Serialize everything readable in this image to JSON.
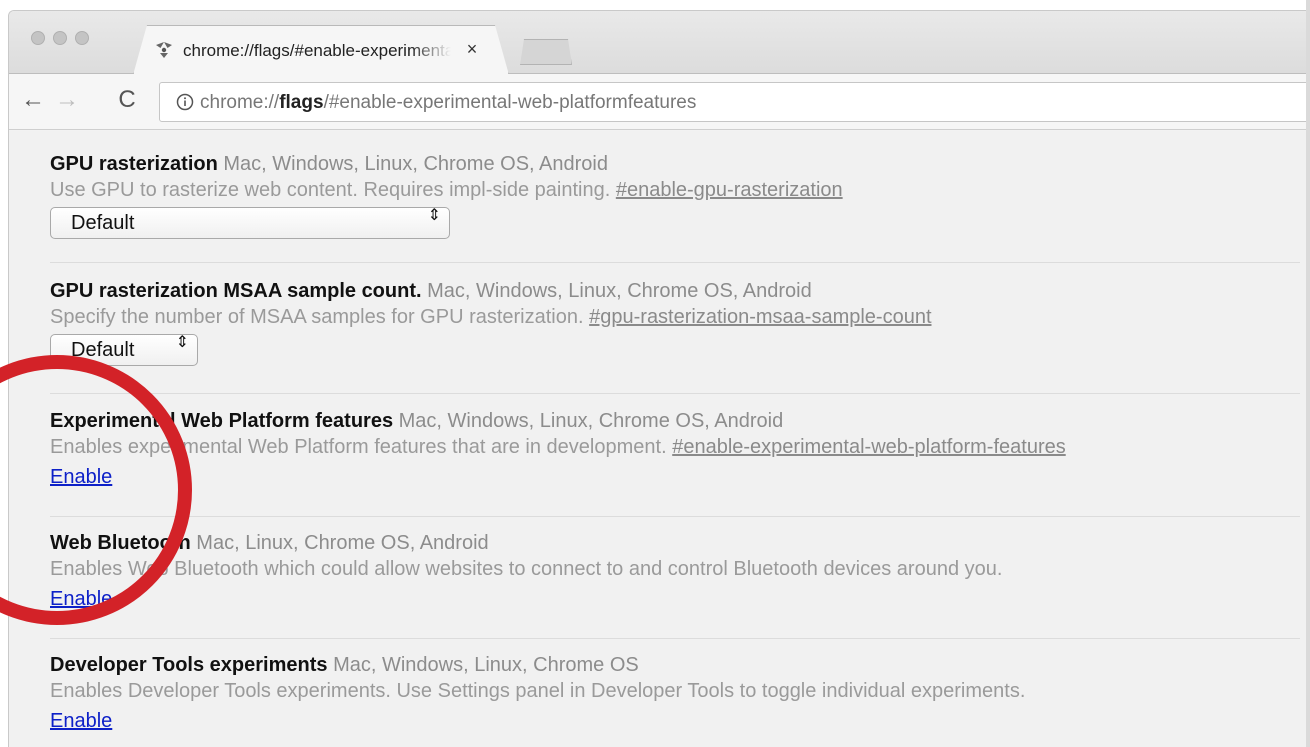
{
  "tab": {
    "title": "chrome://flags/#enable-experimental-web-platform-features",
    "close": "×"
  },
  "toolbar": {
    "back": "←",
    "forward": "→",
    "reload": "C",
    "url_prefix": "chrome://",
    "url_bold": "flags",
    "url_suffix": "/#enable-experimental-web-platformfeatures"
  },
  "flags": [
    {
      "name": "GPU rasterization",
      "platforms": "Mac, Windows, Linux, Chrome OS, Android",
      "description": "Use GPU to rasterize web content. Requires impl-side painting.",
      "anchor": "#enable-gpu-rasterization",
      "control": "select",
      "value": "Default"
    },
    {
      "name": "GPU rasterization MSAA sample count.",
      "platforms": "Mac, Windows, Linux, Chrome OS, Android",
      "description": "Specify the number of MSAA samples for GPU rasterization.",
      "anchor": "#gpu-rasterization-msaa-sample-count",
      "control": "select",
      "value": "Default"
    },
    {
      "name": "Experimental Web Platform features",
      "platforms": "Mac, Windows, Linux, Chrome OS, Android",
      "description": "Enables experimental Web Platform features that are in development.",
      "anchor": "#enable-experimental-web-platform-features",
      "control": "link",
      "value": "Enable"
    },
    {
      "name": "Web Bluetooth",
      "platforms": "Mac, Linux, Chrome OS, Android",
      "description": "Enables Web Bluetooth which could allow websites to connect to and control Bluetooth devices around you.",
      "anchor": "",
      "control": "link",
      "value": "Enable"
    },
    {
      "name": "Developer Tools experiments",
      "platforms": "Mac, Windows, Linux, Chrome OS",
      "description": "Enables Developer Tools experiments. Use Settings panel in Developer Tools to toggle individual experiments.",
      "anchor": "",
      "control": "link",
      "value": "Enable"
    }
  ],
  "select_arrows": "⇕",
  "colors": {
    "annotation": "#d32228",
    "link": "#0d20c8"
  }
}
